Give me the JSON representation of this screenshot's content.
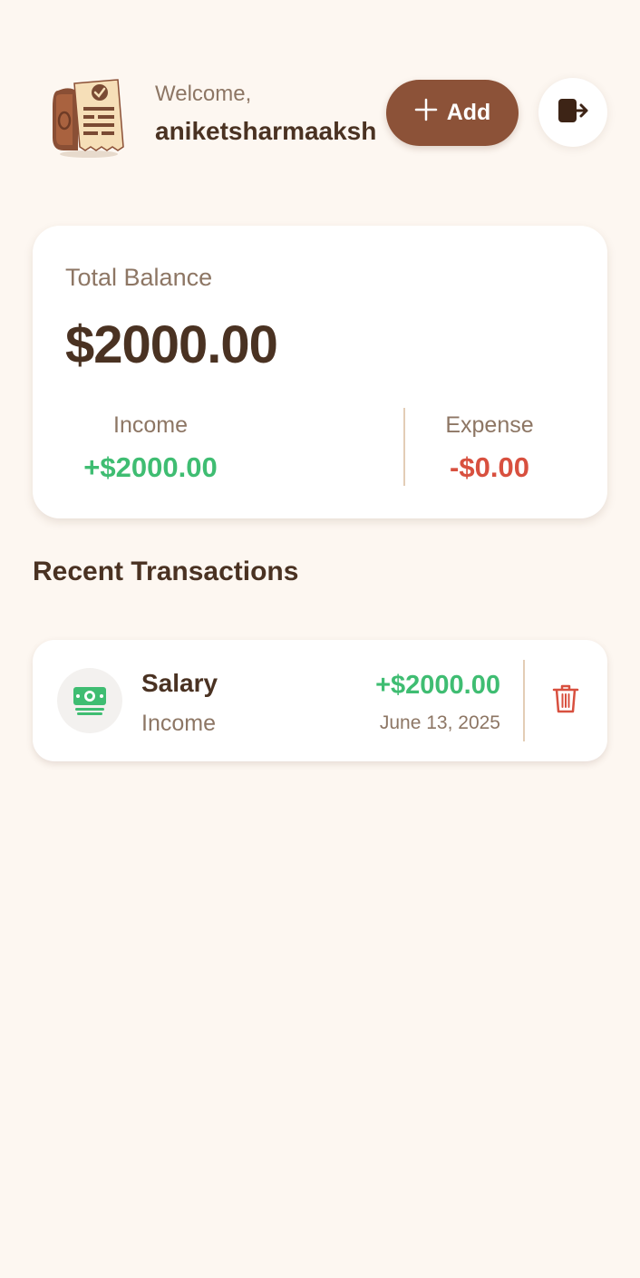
{
  "header": {
    "logo_icon": "receipt-ledger-logo",
    "welcome_label": "Welcome,",
    "username": "aniketsharmaaksh",
    "add_label": "Add",
    "add_icon": "plus-icon",
    "logout_icon": "logout-icon"
  },
  "balance": {
    "title": "Total Balance",
    "amount": "$2000.00",
    "income_label": "Income",
    "income_value": "+$2000.00",
    "expense_label": "Expense",
    "expense_value": "-$0.00"
  },
  "recent": {
    "title": "Recent Transactions",
    "transactions": [
      {
        "name": "Salary",
        "category": "Income",
        "amount": "+$2000.00",
        "date": "June 13, 2025",
        "icon": "money-icon",
        "delete_icon": "trash-icon"
      }
    ]
  },
  "colors": {
    "background": "#fdf7f1",
    "accent": "#8c5238",
    "income": "#3fbd72",
    "expense": "#d8503f",
    "text_primary": "#4a3222",
    "text_secondary": "#8d7664"
  }
}
